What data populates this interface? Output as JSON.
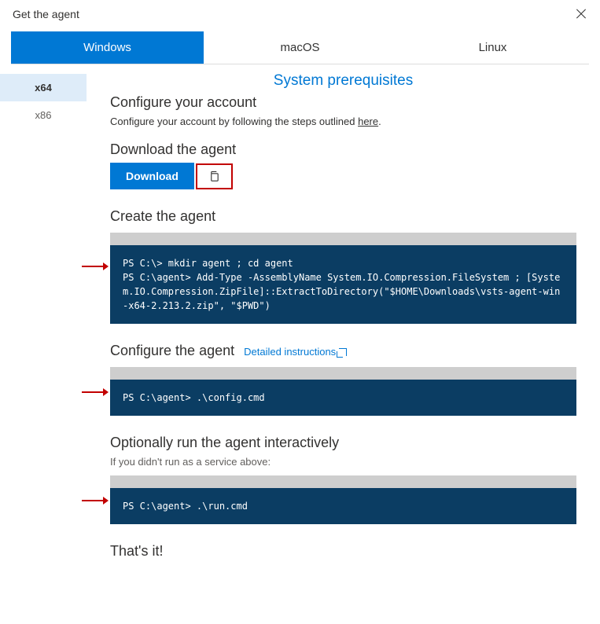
{
  "header": {
    "title": "Get the agent"
  },
  "tabs": {
    "windows": "Windows",
    "macos": "macOS",
    "linux": "Linux"
  },
  "sidebar": {
    "x64": "x64",
    "x86": "x86"
  },
  "prereq": "System prerequisites",
  "sections": {
    "configure_account": {
      "title": "Configure your account",
      "text_before": "Configure your account by following the steps outlined ",
      "link": "here",
      "text_after": "."
    },
    "download_agent": {
      "title": "Download the agent",
      "button": "Download"
    },
    "create_agent": {
      "title": "Create the agent",
      "code": "PS C:\\> mkdir agent ; cd agent\nPS C:\\agent> Add-Type -AssemblyName System.IO.Compression.FileSystem ; [System.IO.Compression.ZipFile]::ExtractToDirectory(\"$HOME\\Downloads\\vsts-agent-win-x64-2.213.2.zip\", \"$PWD\")"
    },
    "configure_agent": {
      "title": "Configure the agent",
      "detail_link": "Detailed instructions",
      "code": "PS C:\\agent> .\\config.cmd"
    },
    "run_agent": {
      "title": "Optionally run the agent interactively",
      "note": "If you didn't run as a service above:",
      "code": "PS C:\\agent> .\\run.cmd"
    },
    "done": {
      "title": "That's it!"
    }
  }
}
